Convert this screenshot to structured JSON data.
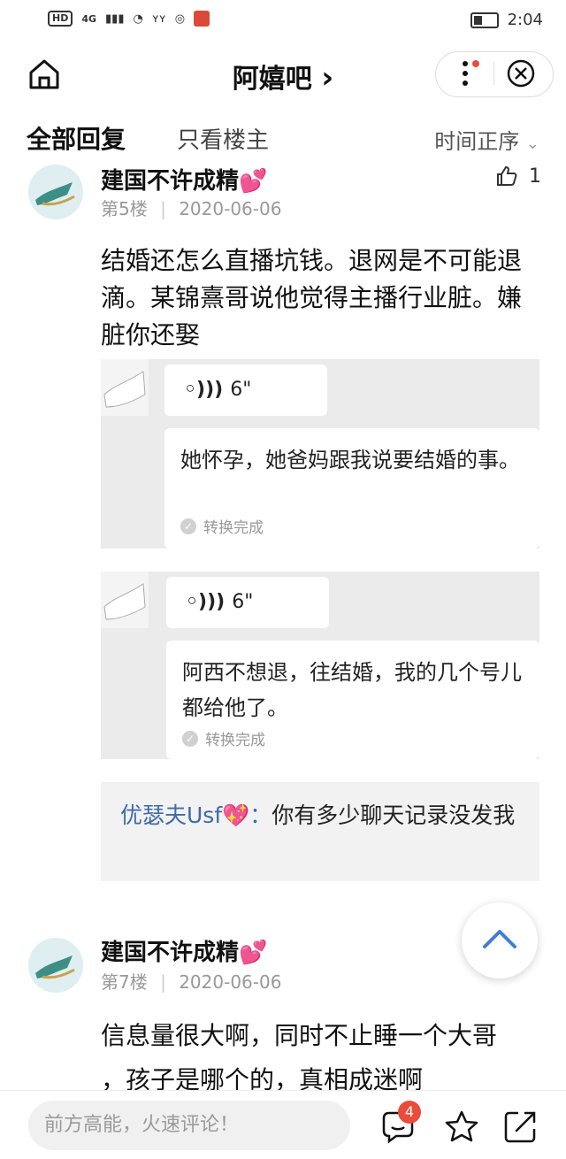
{
  "status_bar": {
    "hd": "HD",
    "net": "4G",
    "left_text": "ʏʏ",
    "time": "2:04"
  },
  "header": {
    "title": "阿嬉吧",
    "chevron": "›"
  },
  "tabs": {
    "all": "全部回复",
    "op_only": "只看楼主",
    "sort": "时间正序"
  },
  "posts": [
    {
      "username": "建国不许成精",
      "emoji": "💕",
      "floor": "第5楼",
      "date": "2020-06-06",
      "likes": "1",
      "text": "结婚还怎么直播坑钱。退网是不可能退滴。某锦熹哥说他觉得主播行业脏。嫌脏你还娶",
      "voice_cards": [
        {
          "duration": "6\"",
          "transcript": "她怀孕，她爸妈跟我说要结婚的事。",
          "status": "转换完成"
        },
        {
          "duration": "6\"",
          "transcript": "阿西不想退，往结婚，我的几个号儿都给他了。",
          "status": "转换完成"
        }
      ],
      "reply": {
        "name": "优瑟夫Usf💖",
        "sep": "：",
        "text": "你有多少聊天记录没发我"
      }
    },
    {
      "username": "建国不许成精",
      "emoji": "💕",
      "floor": "第7楼",
      "date": "2020-06-06",
      "text_line1": "信息量很大啊，同时不止睡一个大哥",
      "text_line2": "，孩子是哪个的，真相成迷啊"
    }
  ],
  "bottom_bar": {
    "placeholder": "前方高能，火速评论！",
    "comment_count": "4"
  },
  "icons": [
    "home-icon",
    "more-icon",
    "close-icon",
    "chevron-down-icon",
    "thumbs-up-icon",
    "voice-icon",
    "check-icon",
    "scroll-top-icon",
    "comment-icon",
    "star-icon",
    "share-icon"
  ],
  "colors": {
    "accent_red": "#e74c3c",
    "link_blue": "#3e6aa8"
  }
}
